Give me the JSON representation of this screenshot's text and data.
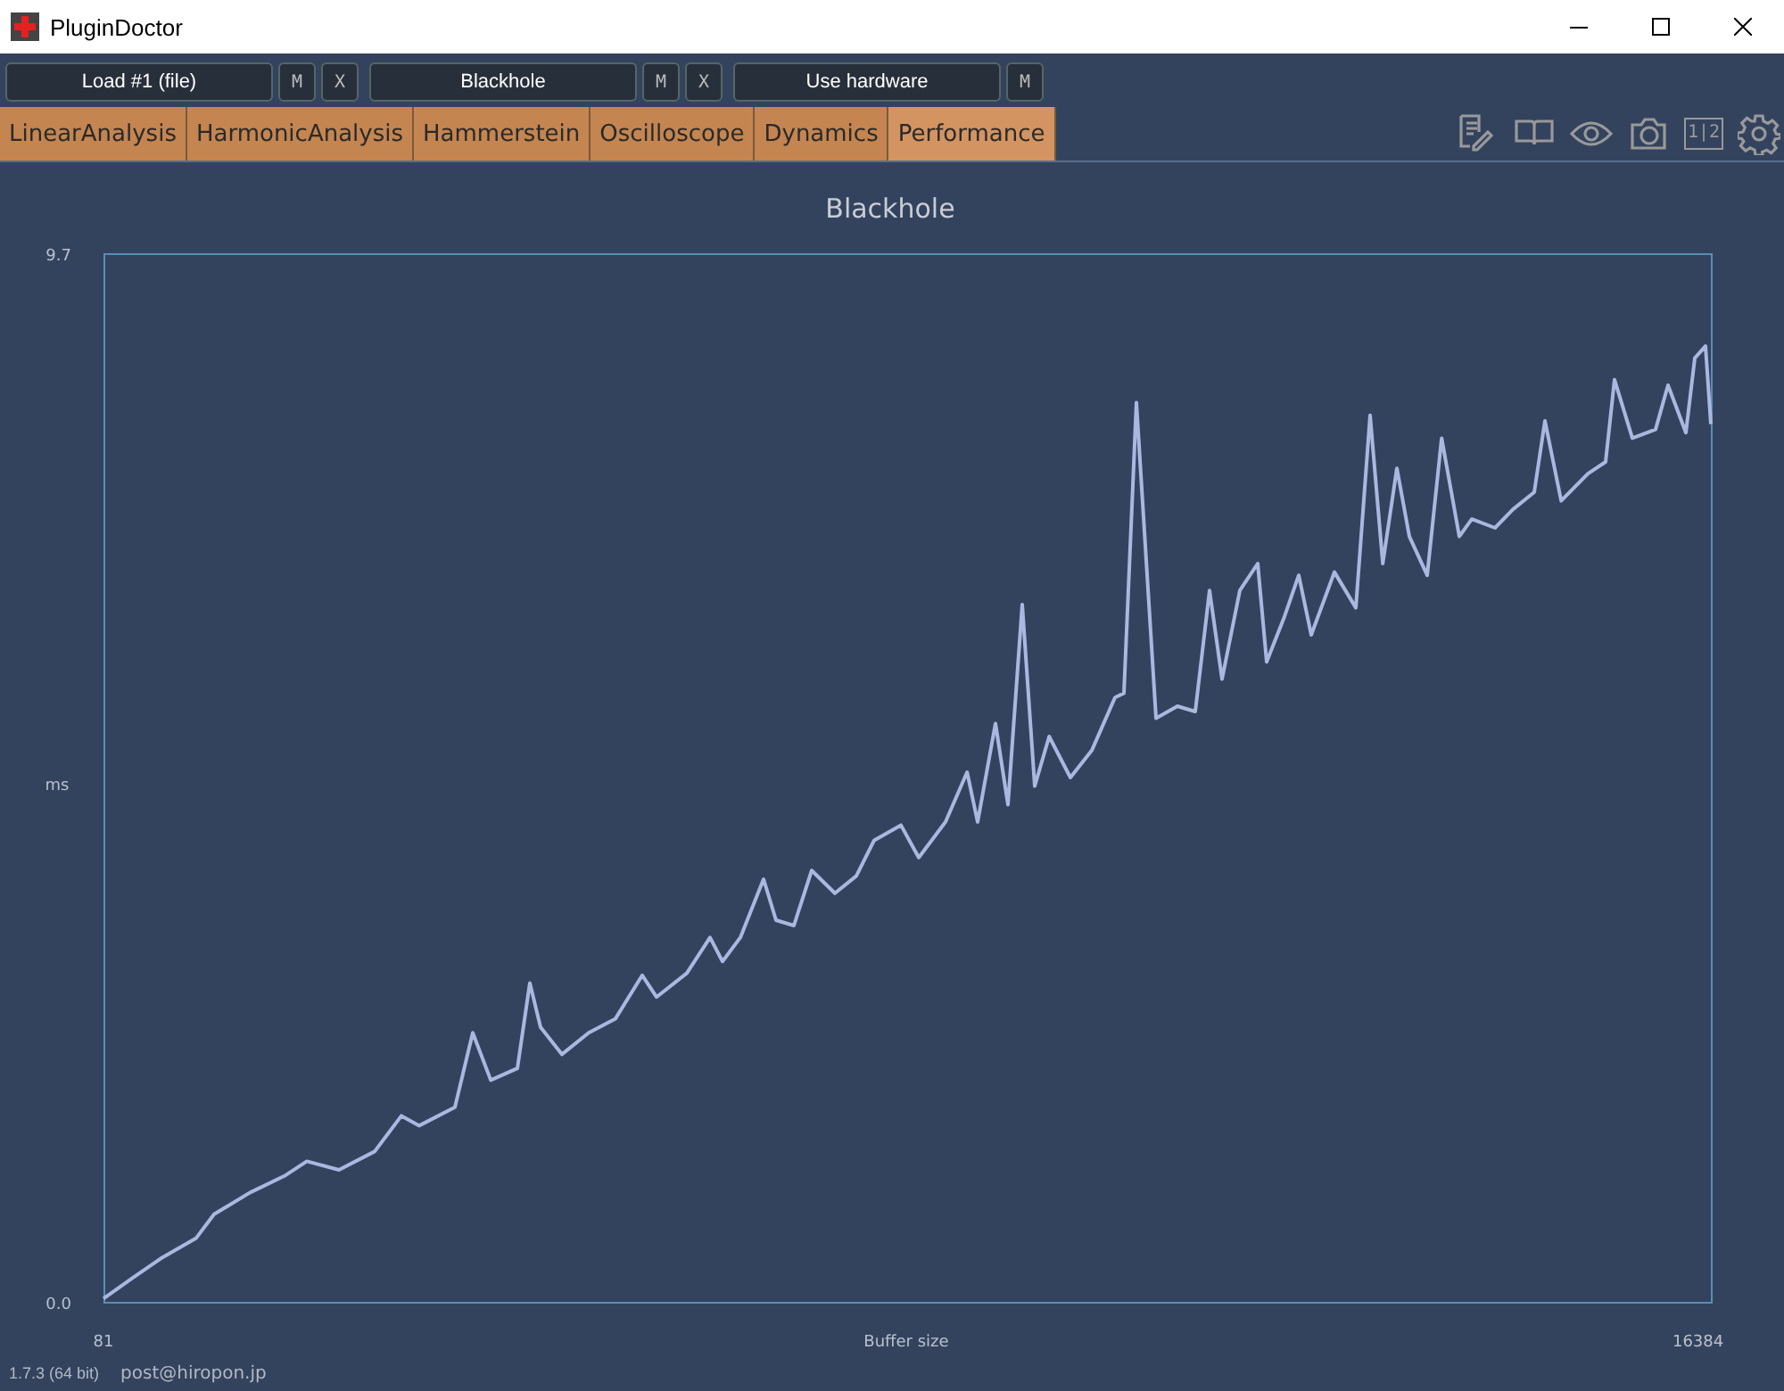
{
  "window": {
    "title": "PluginDoctor"
  },
  "slots": [
    {
      "label": "Load #1 (file)",
      "buttons": [
        "M",
        "X"
      ]
    },
    {
      "label": "Blackhole",
      "buttons": [
        "M",
        "X"
      ]
    },
    {
      "label": "Use hardware",
      "buttons": [
        "M"
      ]
    }
  ],
  "tabs": [
    {
      "label": "LinearAnalysis",
      "selected": false
    },
    {
      "label": "HarmonicAnalysis",
      "selected": false
    },
    {
      "label": "Hammerstein",
      "selected": false
    },
    {
      "label": "Oscilloscope",
      "selected": false
    },
    {
      "label": "Dynamics",
      "selected": false
    },
    {
      "label": "Performance",
      "selected": true
    }
  ],
  "tools": [
    {
      "kind": "notes"
    },
    {
      "kind": "book"
    },
    {
      "kind": "eye"
    },
    {
      "kind": "camera"
    },
    {
      "kind": "split",
      "text": "1|2"
    },
    {
      "kind": "gear"
    }
  ],
  "chart": {
    "chart_data": {
      "type": "line",
      "title": "Blackhole",
      "xlabel": "Buffer size",
      "ylabel": "ms",
      "xlim": [
        81,
        16515
      ],
      "ylim": [
        0,
        9.7
      ],
      "xticks": [
        81,
        16384
      ],
      "yticks": [
        {
          "value": 0,
          "label": "0.0"
        },
        {
          "value": 9.7,
          "label": "9.7"
        }
      ],
      "x": [
        81,
        392,
        665,
        1030,
        1212,
        1576,
        1941,
        2160,
        2489,
        2854,
        3127,
        3310,
        3675,
        3857,
        4040,
        4313,
        4441,
        4550,
        4769,
        5042,
        5316,
        5589,
        5736,
        6045,
        6283,
        6410,
        6593,
        6830,
        6958,
        7140,
        7323,
        7560,
        7778,
        7961,
        8234,
        8417,
        8690,
        8910,
        9019,
        9201,
        9329,
        9474,
        9602,
        9749,
        9967,
        10186,
        10423,
        10514,
        10642,
        10843,
        11061,
        11244,
        11390,
        11517,
        11700,
        11882,
        11974,
        12156,
        12302,
        12430,
        12667,
        12885,
        13032,
        13160,
        13305,
        13433,
        13615,
        13762,
        13943,
        14071,
        14308,
        14491,
        14709,
        14819,
        14984,
        15257,
        15439,
        15530,
        15713,
        15950,
        16078,
        16260,
        16351,
        16461,
        16515
      ],
      "series": [
        {
          "color": "#aab8e0",
          "values": [
            0.03,
            0.23,
            0.4,
            0.59,
            0.81,
            1.01,
            1.17,
            1.3,
            1.22,
            1.39,
            1.72,
            1.63,
            1.8,
            2.49,
            2.05,
            2.16,
            2.95,
            2.54,
            2.29,
            2.49,
            2.62,
            3.02,
            2.82,
            3.04,
            3.37,
            3.15,
            3.37,
            3.91,
            3.53,
            3.48,
            3.99,
            3.78,
            3.94,
            4.27,
            4.41,
            4.11,
            4.44,
            4.9,
            4.44,
            5.35,
            4.6,
            6.45,
            4.77,
            5.23,
            4.85,
            5.1,
            5.59,
            5.63,
            8.32,
            5.4,
            5.51,
            5.46,
            6.58,
            5.76,
            6.58,
            6.83,
            5.92,
            6.34,
            6.72,
            6.17,
            6.75,
            6.42,
            8.2,
            6.83,
            7.71,
            7.08,
            6.72,
            7.99,
            7.08,
            7.24,
            7.16,
            7.33,
            7.49,
            8.15,
            7.41,
            7.66,
            7.77,
            8.53,
            7.99,
            8.07,
            8.48,
            8.04,
            8.73,
            8.84,
            8.12
          ]
        }
      ]
    }
  },
  "footer": {
    "version": "1.7.3 (64 bit)",
    "contact": "post@hiropon.jp"
  }
}
